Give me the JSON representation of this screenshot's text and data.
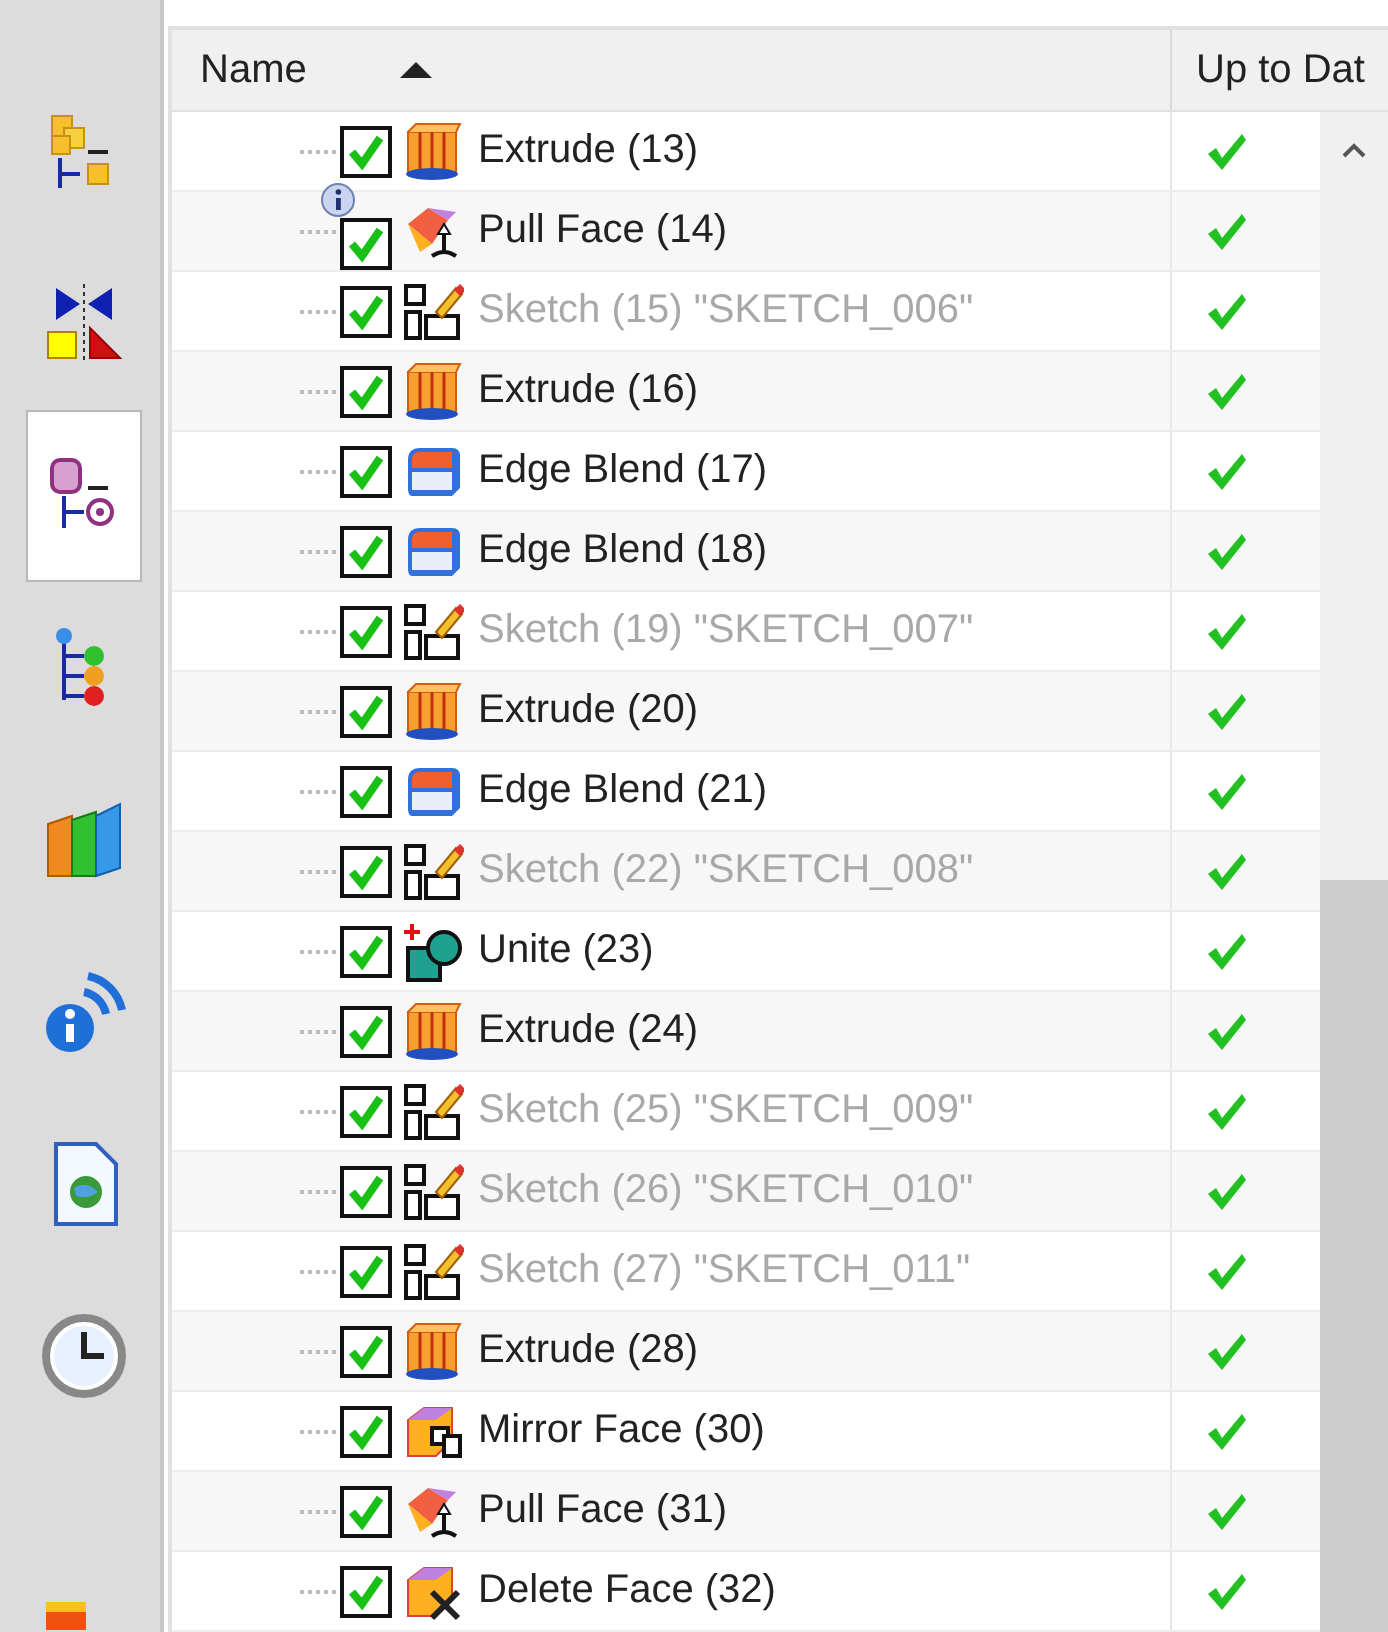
{
  "sidebar": {
    "tabs": [
      {
        "kind": "assembly",
        "selected": false
      },
      {
        "kind": "constraints",
        "selected": false
      },
      {
        "kind": "part",
        "selected": true
      },
      {
        "kind": "roles",
        "selected": false
      },
      {
        "kind": "library",
        "selected": false
      },
      {
        "kind": "info",
        "selected": false
      },
      {
        "kind": "document",
        "selected": false
      },
      {
        "kind": "history",
        "selected": false
      },
      {
        "kind": "partial",
        "selected": false
      }
    ]
  },
  "table": {
    "columns": [
      {
        "label": "Name",
        "sorted_ascending": true
      },
      {
        "label": "Up to Dat"
      }
    ],
    "rows": [
      {
        "kind": "extrude",
        "label": "Extrude (13)",
        "checked": true,
        "dimmed": false,
        "info_badge": false,
        "up_to_date": true
      },
      {
        "kind": "pull-face",
        "label": "Pull Face (14)",
        "checked": true,
        "dimmed": false,
        "info_badge": true,
        "up_to_date": true
      },
      {
        "kind": "sketch",
        "label": "Sketch (15) \"SKETCH_006\"",
        "checked": true,
        "dimmed": true,
        "info_badge": false,
        "up_to_date": true
      },
      {
        "kind": "extrude",
        "label": "Extrude (16)",
        "checked": true,
        "dimmed": false,
        "info_badge": false,
        "up_to_date": true
      },
      {
        "kind": "edge-blend",
        "label": "Edge Blend (17)",
        "checked": true,
        "dimmed": false,
        "info_badge": false,
        "up_to_date": true
      },
      {
        "kind": "edge-blend",
        "label": "Edge Blend (18)",
        "checked": true,
        "dimmed": false,
        "info_badge": false,
        "up_to_date": true
      },
      {
        "kind": "sketch",
        "label": "Sketch (19) \"SKETCH_007\"",
        "checked": true,
        "dimmed": true,
        "info_badge": false,
        "up_to_date": true
      },
      {
        "kind": "extrude",
        "label": "Extrude (20)",
        "checked": true,
        "dimmed": false,
        "info_badge": false,
        "up_to_date": true
      },
      {
        "kind": "edge-blend",
        "label": "Edge Blend (21)",
        "checked": true,
        "dimmed": false,
        "info_badge": false,
        "up_to_date": true
      },
      {
        "kind": "sketch",
        "label": "Sketch (22) \"SKETCH_008\"",
        "checked": true,
        "dimmed": true,
        "info_badge": false,
        "up_to_date": true
      },
      {
        "kind": "unite",
        "label": "Unite (23)",
        "checked": true,
        "dimmed": false,
        "info_badge": false,
        "up_to_date": true
      },
      {
        "kind": "extrude",
        "label": "Extrude (24)",
        "checked": true,
        "dimmed": false,
        "info_badge": false,
        "up_to_date": true
      },
      {
        "kind": "sketch",
        "label": "Sketch (25) \"SKETCH_009\"",
        "checked": true,
        "dimmed": true,
        "info_badge": false,
        "up_to_date": true
      },
      {
        "kind": "sketch",
        "label": "Sketch (26) \"SKETCH_010\"",
        "checked": true,
        "dimmed": true,
        "info_badge": false,
        "up_to_date": true
      },
      {
        "kind": "sketch",
        "label": "Sketch (27) \"SKETCH_011\"",
        "checked": true,
        "dimmed": true,
        "info_badge": false,
        "up_to_date": true
      },
      {
        "kind": "extrude",
        "label": "Extrude (28)",
        "checked": true,
        "dimmed": false,
        "info_badge": false,
        "up_to_date": true
      },
      {
        "kind": "mirror-face",
        "label": "Mirror Face (30)",
        "checked": true,
        "dimmed": false,
        "info_badge": false,
        "up_to_date": true
      },
      {
        "kind": "pull-face",
        "label": "Pull Face (31)",
        "checked": true,
        "dimmed": false,
        "info_badge": false,
        "up_to_date": true
      },
      {
        "kind": "delete-face",
        "label": "Delete Face (32)",
        "checked": true,
        "dimmed": false,
        "info_badge": false,
        "up_to_date": true
      }
    ]
  }
}
